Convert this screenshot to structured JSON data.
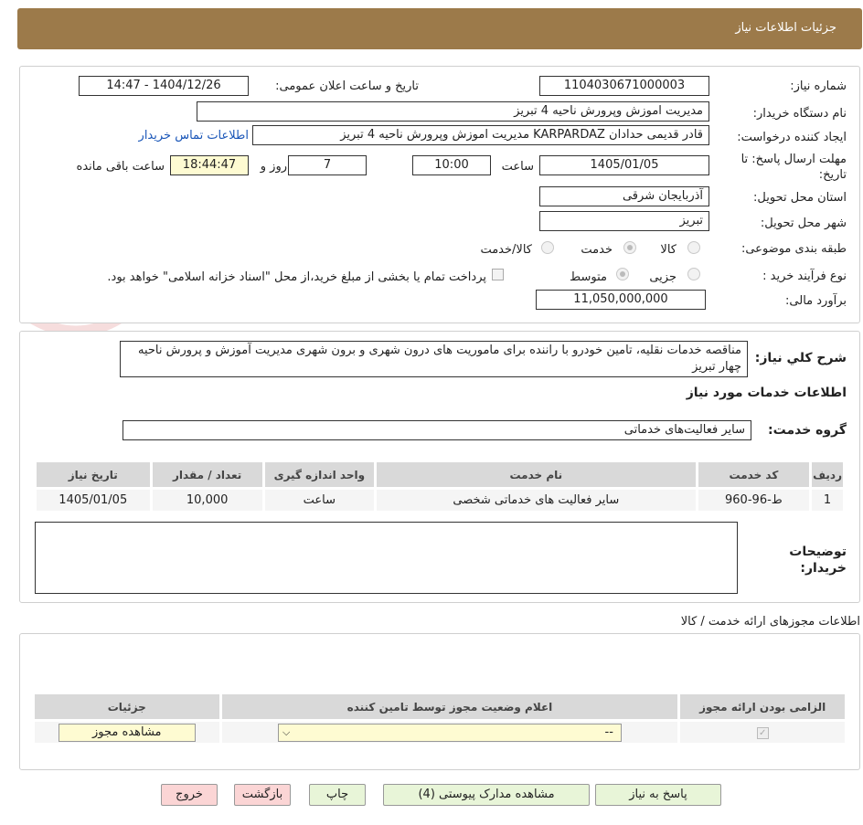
{
  "header": {
    "title": "جزئیات اطلاعات نیاز"
  },
  "form": {
    "need_number_label": "شماره نیاز:",
    "need_number": "1104030671000003",
    "announce_label": "تاریخ و ساعت اعلان عمومی:",
    "announce_value": "1404/12/26 - 14:47",
    "buyer_org_label": "نام دستگاه خریدار:",
    "buyer_org": "مدیریت اموزش وپرورش ناحیه 4 تبریز",
    "creator_label": "ایجاد کننده درخواست:",
    "creator": "قادر قدیمی حدادان KARPARDAZ مدیریت اموزش وپرورش ناحیه 4 تبریز",
    "contact_link": "اطلاعات تماس خریدار",
    "deadline_label": "مهلت ارسال پاسخ: تا تاریخ:",
    "deadline_date": "1405/01/05",
    "time_label": "ساعت",
    "deadline_time": "10:00",
    "days_value": "7",
    "days_label": "روز و",
    "remaining_time": "18:44:47",
    "remaining_label": "ساعت باقی مانده",
    "province_label": "استان محل تحویل:",
    "province": "آذربایجان شرقی",
    "city_label": "شهر محل تحویل:",
    "city": "تبریز",
    "category_label": "طبقه بندی موضوعی:",
    "category_options": [
      "کالا",
      "خدمت",
      "کالا/خدمت"
    ],
    "category_selected": "خدمت",
    "process_label": "نوع فرآیند خرید :",
    "process_options": [
      "جزیی",
      "متوسط"
    ],
    "process_selected": "متوسط",
    "payment_note": "پرداخت تمام یا بخشی از مبلغ خرید،از محل \"اسناد خزانه اسلامی\" خواهد بود.",
    "budget_label": "برآورد مالی:",
    "budget": "11,050,000,000"
  },
  "description": {
    "label": "شرح کلي نياز:",
    "text": "مناقصه خدمات نقلیه، تامین خودرو با راننده برای ماموریت های درون شهری و برون شهری مدیریت آموزش و پرورش ناحیه چهار تبریز",
    "services_title": "اطلاعات خدمات مورد نياز",
    "group_label": "گروه خدمت:",
    "group_value": "سایر فعالیت‌های خدماتی"
  },
  "services_table": {
    "headers": [
      "ردیف",
      "کد خدمت",
      "نام خدمت",
      "واحد اندازه گیری",
      "تعداد / مقدار",
      "تاریخ نیاز"
    ],
    "rows": [
      [
        "1",
        "ط-96-960",
        "سایر فعالیت های خدماتی شخصی",
        "ساعت",
        "10,000",
        "1405/01/05"
      ]
    ]
  },
  "buyer_notes_label": "توضيحات خريدار:",
  "permits": {
    "title": "اطلاعات مجوزهای ارائه خدمت / کالا",
    "headers": [
      "الزامی بودن ارائه مجوز",
      "اعلام وضعیت مجوز توسط تامین کننده",
      "جزئیات"
    ],
    "select_value": "--",
    "view_button": "مشاهده مجوز"
  },
  "buttons": {
    "reply": "پاسخ به نیاز",
    "attachments": "مشاهده مدارک پیوستی (4)",
    "print": "چاپ",
    "back": "بازگشت",
    "exit": "خروج"
  }
}
